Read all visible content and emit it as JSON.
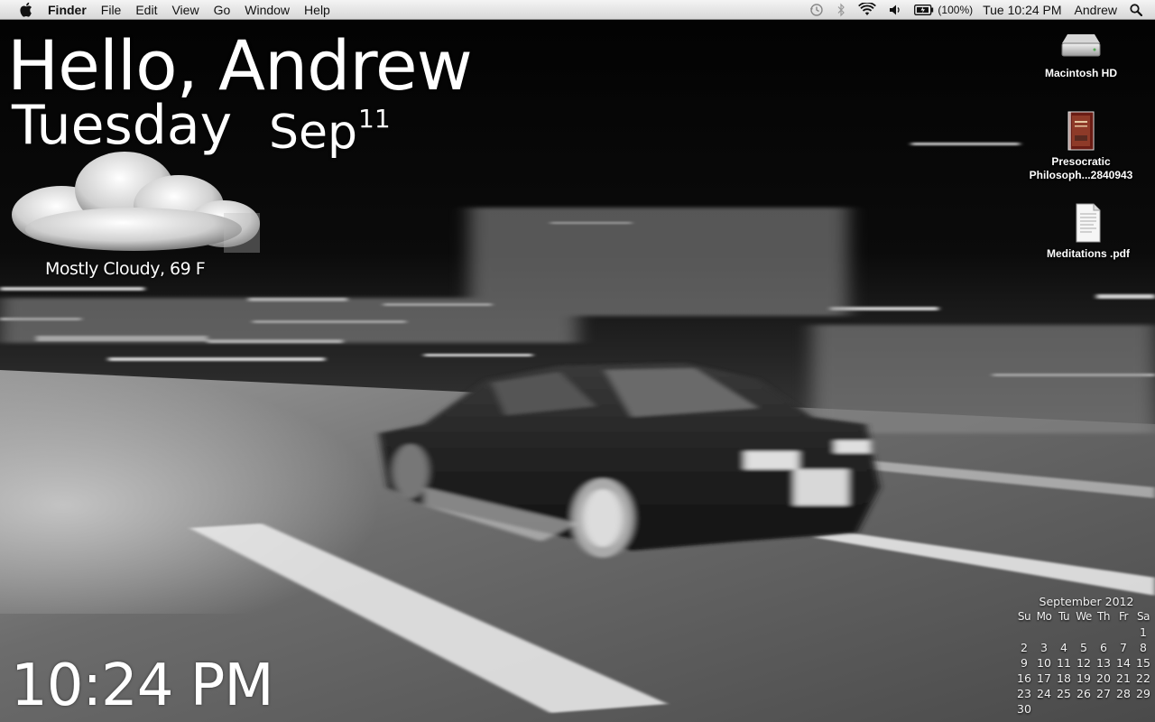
{
  "menubar": {
    "app_name": "Finder",
    "menus": [
      "File",
      "Edit",
      "View",
      "Go",
      "Window",
      "Help"
    ],
    "battery": "(100%)",
    "datetime": "Tue 10:24 PM",
    "user": "Andrew",
    "status_icons": [
      "time-machine-icon",
      "bluetooth-icon",
      "wifi-icon",
      "volume-icon",
      "battery-icon",
      "spotlight-icon"
    ]
  },
  "greeting": {
    "hello": "Hello, Andrew",
    "day_name": "Tuesday",
    "month": "Sep",
    "day_num": "11"
  },
  "weather": {
    "text": "Mostly Cloudy, 69 F",
    "icon": "cloud-icon"
  },
  "clock": "10:24 PM",
  "desktop_icons": [
    {
      "label": "Macintosh HD",
      "icon": "hard-drive-icon"
    },
    {
      "label": "Presocratic Philosoph...2840943",
      "icon": "book-icon"
    },
    {
      "label": "Meditations .pdf",
      "icon": "pdf-document-icon"
    }
  ],
  "calendar": {
    "title": "September 2012",
    "weekdays": [
      "Su",
      "Mo",
      "Tu",
      "We",
      "Th",
      "Fr",
      "Sa"
    ],
    "weeks": [
      [
        "",
        "",
        "",
        "",
        "",
        "",
        "1"
      ],
      [
        "2",
        "3",
        "4",
        "5",
        "6",
        "7",
        "8"
      ],
      [
        "9",
        "10",
        "11",
        "12",
        "13",
        "14",
        "15"
      ],
      [
        "16",
        "17",
        "18",
        "19",
        "20",
        "21",
        "22"
      ],
      [
        "23",
        "24",
        "25",
        "26",
        "27",
        "28",
        "29"
      ],
      [
        "30",
        "",
        "",
        "",
        "",
        "",
        ""
      ]
    ]
  },
  "colors": {
    "menubar_bg": "#e6e6e6",
    "text_light": "#ffffff",
    "wallpaper_dark": "#050505"
  }
}
